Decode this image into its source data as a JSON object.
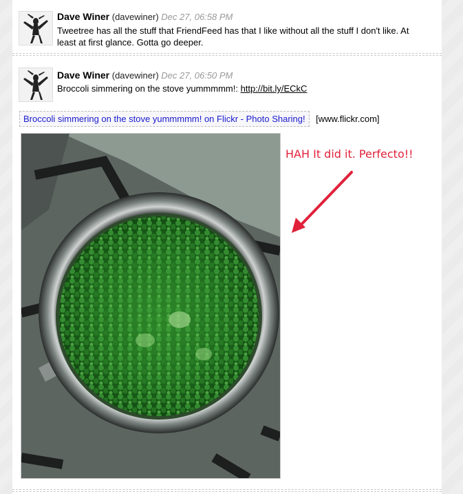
{
  "tweets": [
    {
      "author": "Dave Winer",
      "handle": "(davewiner)",
      "time": "Dec 27, 06:58 PM",
      "text": "Tweetree has all the stuff that FriendFeed has that I like without all the stuff I don't like. At least at first glance. Gotta go deeper."
    },
    {
      "author": "Dave Winer",
      "handle": "(davewiner)",
      "time": "Dec 27, 06:50 PM",
      "text_prefix": "Broccoli simmering on the stove yummmmm!: ",
      "link": "http://bit.ly/ECkC",
      "preview": {
        "title": "Broccoli simmering on the stove yummmmm! on Flickr - Photo Sharing!",
        "domain": "[www.flickr.com]"
      },
      "annotation": "HAH It did it. Perfecto!!"
    }
  ],
  "colors": {
    "link_blue": "#1a1acc",
    "annotation_red": "#e0213a",
    "timestamp_gray": "#999999"
  }
}
